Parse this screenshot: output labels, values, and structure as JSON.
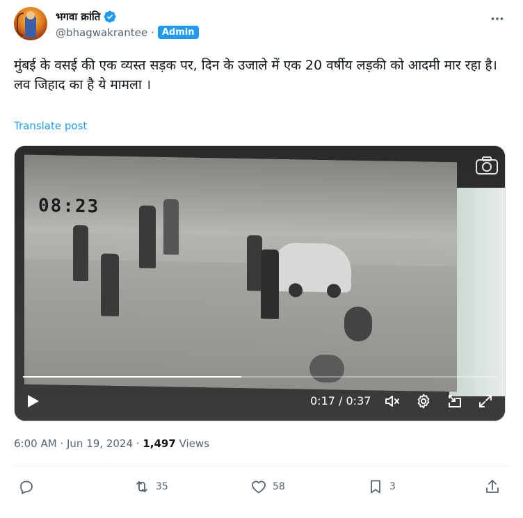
{
  "author": {
    "display_name": "भगवा क्रांति",
    "handle": "@bhagwakrantee",
    "separator": "·",
    "badge": "Admin",
    "verified": true
  },
  "post": {
    "text_line1": "मुंबई के वसई की एक व्यस्त सड़क पर, दिन के उजाले में एक 20 वर्षीय लड़की को आदमी मार रहा है।",
    "text_line2": "लव जिहाद का है ये मामला ।",
    "translate_label": "Translate post"
  },
  "video": {
    "overlay_timestamp": "08:23",
    "current_time": "0:17",
    "duration": "0:37",
    "time_display": "0:17 / 0:37",
    "progress_fraction": 0.46,
    "icons": [
      "play-icon",
      "camera-icon",
      "mute-icon",
      "settings-icon",
      "pip-icon",
      "fullscreen-icon"
    ]
  },
  "meta": {
    "time": "6:00 AM",
    "sep1": "·",
    "date": "Jun 19, 2024",
    "sep2": "·",
    "views_count": "1,497",
    "views_label": "Views"
  },
  "actions": {
    "reply_count": "",
    "repost_count": "35",
    "like_count": "58",
    "bookmark_count": "3"
  },
  "colors": {
    "accent": "#1d9bf0",
    "text": "#0f1419",
    "secondary": "#536471"
  }
}
